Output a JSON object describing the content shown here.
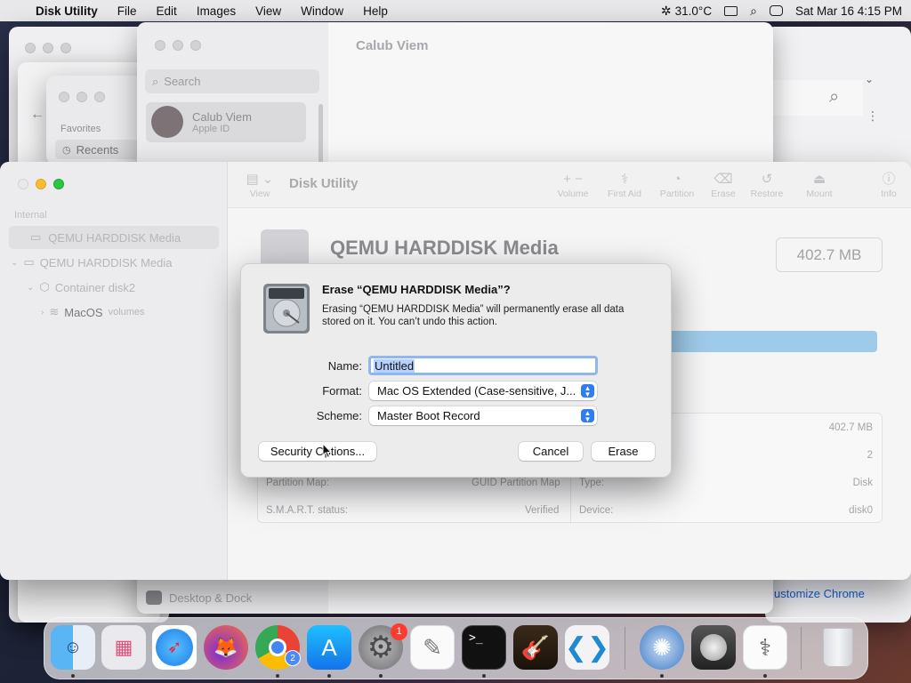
{
  "menubar": {
    "app_name": "Disk Utility",
    "items": [
      "File",
      "Edit",
      "Images",
      "View",
      "Window",
      "Help"
    ],
    "temperature": "31.0°C",
    "datetime": "Sat Mar 16  4:15 PM"
  },
  "bg_settings": {
    "search_placeholder": "Search",
    "account_name": "Calub Viem",
    "account_sub": "Apple ID",
    "header_title": "Calub Viem",
    "desktop_dock": "Desktop & Dock"
  },
  "bg_finder": {
    "favorites": "Favorites",
    "recents": "Recents"
  },
  "bg_chrome": {
    "customize": "ustomize Chrome"
  },
  "disk_utility": {
    "title": "Disk Utility",
    "view_label": "View",
    "toolbar": [
      "Volume",
      "First Aid",
      "Partition",
      "Erase",
      "Restore",
      "Mount",
      "Info"
    ],
    "sidebar_section": "Internal",
    "sidebar_items": [
      "QEMU HARDDISK Media",
      "QEMU HARDDISK Media",
      "Container disk2",
      "MacOS"
    ],
    "sidebar_volumes": "volumes",
    "disk_name": "QEMU HARDDISK Media",
    "disk_size": "402.7 MB",
    "info": {
      "capacity_value": "402.7 MB",
      "child_count": "2",
      "partition_map_label": "Partition Map:",
      "partition_map_value": "GUID Partition Map",
      "type_label": "Type:",
      "type_value": "Disk",
      "smart_label": "S.M.A.R.T. status:",
      "smart_value": "Verified",
      "device_label": "Device:",
      "device_value": "disk0"
    }
  },
  "dialog": {
    "title": "Erase “QEMU HARDDISK Media”?",
    "message": "Erasing “QEMU HARDDISK Media” will permanently erase all data stored on it. You can’t undo this action.",
    "name_label": "Name:",
    "name_value": "Untitled",
    "format_label": "Format:",
    "format_value": "Mac OS Extended (Case-sensitive, J...",
    "scheme_label": "Scheme:",
    "scheme_value": "Master Boot Record",
    "security_button": "Security Options...",
    "cancel_button": "Cancel",
    "erase_button": "Erase"
  },
  "dock": {
    "apps": [
      "Finder",
      "Launchpad",
      "Safari",
      "Firefox",
      "Chrome",
      "App Store",
      "System Settings",
      "TextEdit",
      "Terminal",
      "GarageBand",
      "VS Code",
      "Disk Utility",
      "Disk Image",
      "Activity",
      "Trash"
    ],
    "settings_badge": "1",
    "chrome_badge": "2"
  },
  "colors": {
    "accent": "#2e7cf6",
    "progress_bar": "#8ec3e6",
    "traffic_red": "#ff5f57",
    "traffic_yellow": "#febc2e",
    "traffic_green": "#28c840"
  }
}
